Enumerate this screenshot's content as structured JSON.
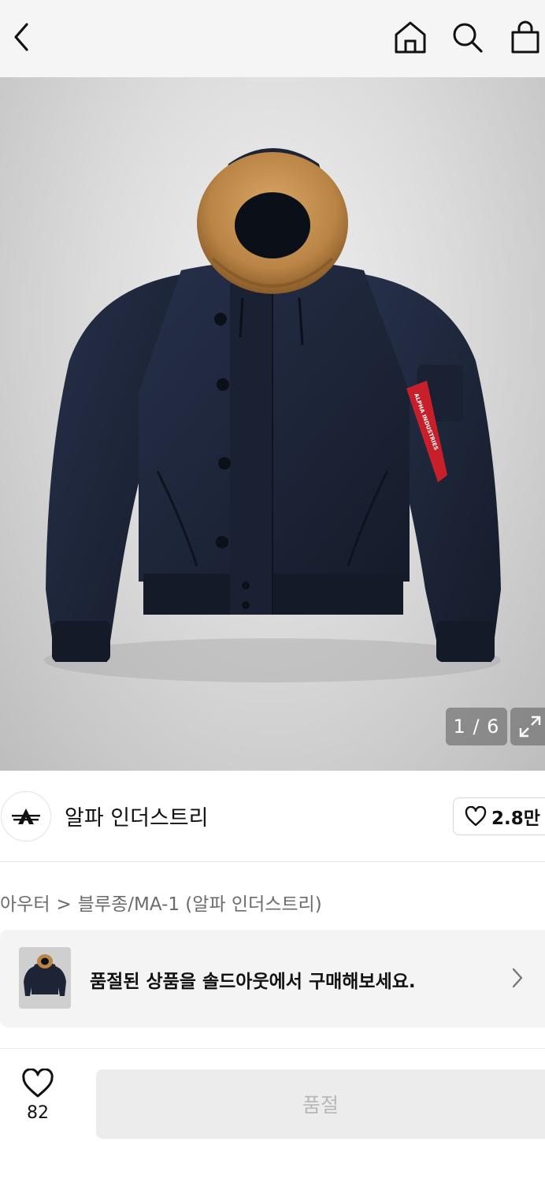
{
  "header": {
    "back_icon": "chevron-left-icon",
    "home_icon": "home-icon",
    "search_icon": "search-icon",
    "bag_icon": "shopping-bag-icon"
  },
  "gallery": {
    "counter": "1 / 6",
    "expand_icon": "expand-icon",
    "sleeve_tag_text": "ALPHA INDUSTRIES"
  },
  "brand": {
    "name": "알파 인더스트리",
    "logo_icon": "alpha-industries-logo",
    "like_count": "2.8만"
  },
  "breadcrumb": {
    "items": [
      "아우터",
      "블루종/MA-1 (알파 인더스트리)"
    ],
    "separator": ">"
  },
  "soldout_banner": {
    "text": "품절된 상품을 솔드아웃에서 구매해보세요."
  },
  "bottom_bar": {
    "like_count": "82",
    "buy_button_label": "품절"
  },
  "colors": {
    "tag_red": "#c8202a",
    "jacket_navy": "#1c2436",
    "fur_brown": "#b98445"
  }
}
